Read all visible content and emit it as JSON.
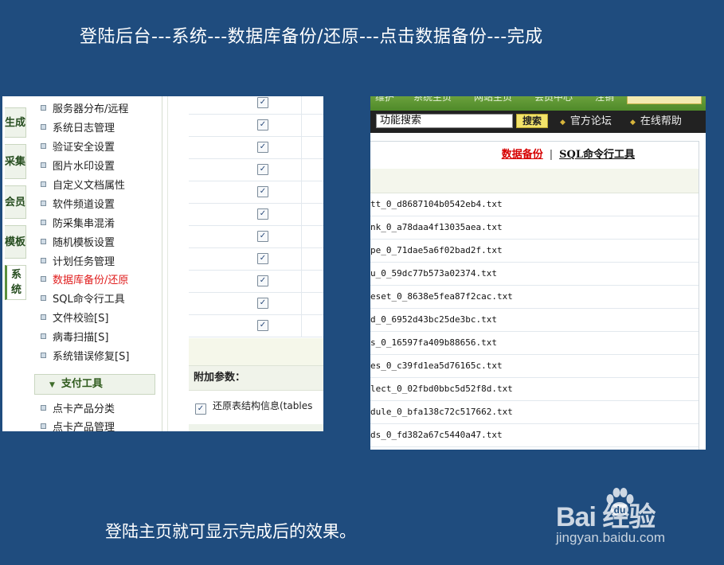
{
  "slide": {
    "title": "登陆后台---系统---数据库备份/还原---点击数据备份---完成",
    "caption": "登陆主页就可显示完成后的效果。"
  },
  "left_screenshot": {
    "vertical_tabs": [
      "生成",
      "采集",
      "会员",
      "模板",
      "系统"
    ],
    "active_tab": "系统",
    "menu_items": [
      "服务器分布/远程",
      "系统日志管理",
      "验证安全设置",
      "图片水印设置",
      "自定义文档属性",
      "软件频道设置",
      "防采集串混淆",
      "随机模板设置",
      "计划任务管理",
      "数据库备份/还原",
      "SQL命令行工具",
      "文件校验[S]",
      "病毒扫描[S]",
      "系统错误修复[S]"
    ],
    "current_item": "数据库备份/还原",
    "group_header": "支付工具",
    "group_items": [
      "点卡产品分类",
      "点卡产品管理"
    ],
    "checkbox_count": 11,
    "extra_params_label": "附加参数：",
    "restore_option": "还原表结构信息(tables"
  },
  "right_screenshot": {
    "nav_items": [
      "维护",
      "系统主页",
      "网站主页",
      "会员中心",
      "注销"
    ],
    "search": {
      "value": "功能搜索",
      "button": "搜索"
    },
    "links": [
      "官方论坛",
      "在线帮助"
    ],
    "tabs": {
      "active": "数据备份",
      "separator": "|",
      "other": "SQL命令行工具"
    },
    "files": [
      "tt_0_d8687104b0542eb4.txt",
      "nk_0_a78daa4f13035aea.txt",
      "pe_0_71dae5a6f02bad2f.txt",
      "u_0_59dc77b573a02374.txt",
      "eset_0_8638e5fea87f2cac.txt",
      "d_0_6952d43bc25de3bc.txt",
      "s_0_16597fa409b88656.txt",
      "es_0_c39fd1ea5d76165c.txt",
      "lect_0_02fbd0bbc5d52f8d.txt",
      "dule_0_bfa138c72c517662.txt",
      "ds_0_fd382a67c5440a47.txt"
    ]
  },
  "watermark": {
    "brand": "Bai  经验",
    "url": "jingyan.baidu.com"
  },
  "colors": {
    "background": "#1f4c7e",
    "accent_green": "#5a8f3c",
    "active_red": "#e01e1e",
    "search_bar": "#222222"
  }
}
